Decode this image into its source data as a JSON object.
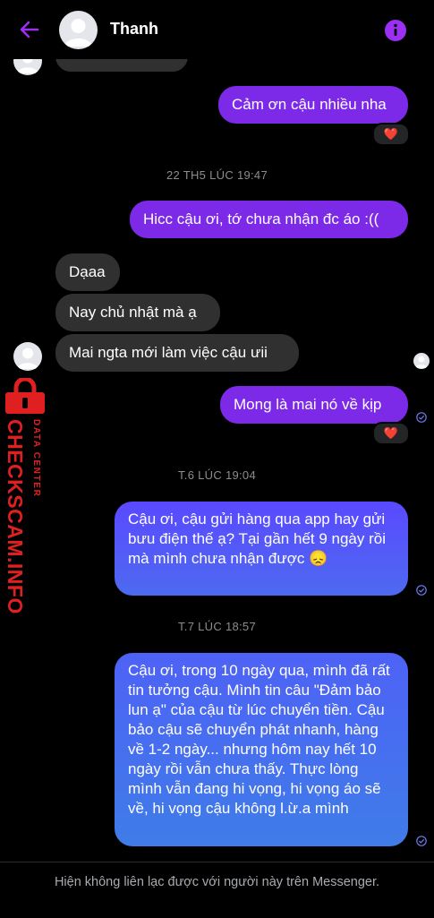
{
  "header": {
    "contact_name": "Thanh",
    "accent_color": "#9b2ff3"
  },
  "messages": {
    "m1": "Cảm ơn cậu nhiều nha",
    "m1_reaction": "❤️",
    "ts1": "22 TH5 LÚC 19:47",
    "m2": "Hicc cậu ơi, tớ chưa nhận đc áo :((",
    "m3": "Dạaa",
    "m4": "Nay chủ nhật mà ạ",
    "m5": "Mai ngta mới làm việc cậu ưii",
    "m6": "Mong là mai nó về kịp",
    "m6_reaction": "❤️",
    "ts2": "T.6 LÚC 19:04",
    "m7": "Cậu ơi, cậu gửi hàng qua app hay gửi bưu điện thế ạ? Tại gần hết 9 ngày rồi mà mình chưa nhận được 😞",
    "ts3": "T.7 LÚC 18:57",
    "m8": "Cậu ơi, trong 10 ngày qua, mình đã rất tin tưởng cậu. Mình tin câu \"Đảm bảo lun ạ\" của cậu từ lúc chuyển tiền. Cậu bảo cậu sẽ chuyển phát nhanh, hàng về 1-2 ngày... nhưng hôm nay hết 10 ngày rồi vẫn chưa thấy. Thực lòng mình vẫn đang hi vọng, hi vọng áo sẽ về, hi vọng cậu không l.ừ.a mình"
  },
  "watermark": {
    "brand": "CHECKSCAM.INFO",
    "tagline": "DATA CENTER",
    "color": "#e02020"
  },
  "footer": {
    "notice": "Hiện không liên lạc được với người này trên Messenger."
  }
}
